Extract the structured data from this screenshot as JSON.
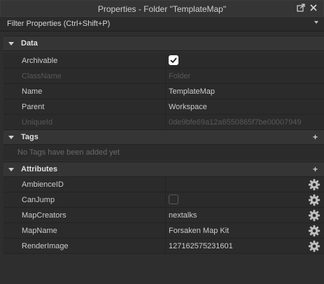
{
  "window": {
    "title": "Properties - Folder \"TemplateMap\""
  },
  "filter": {
    "placeholder": "Filter Properties (Ctrl+Shift+P)"
  },
  "sections": {
    "data": {
      "label": "Data"
    },
    "tags": {
      "label": "Tags",
      "empty_text": "No Tags have been added yet"
    },
    "attributes": {
      "label": "Attributes"
    }
  },
  "data_rows": {
    "archivable": {
      "name": "Archivable",
      "checked": true
    },
    "classname": {
      "name": "ClassName",
      "value": "Folder"
    },
    "name": {
      "name": "Name",
      "value": "TemplateMap"
    },
    "parent": {
      "name": "Parent",
      "value": "Workspace"
    },
    "uniqueid": {
      "name": "UniqueId",
      "value": "0de9bfe69a12a6550865f7be00007949"
    }
  },
  "attribute_rows": {
    "ambienceid": {
      "name": "AmbienceID",
      "value": ""
    },
    "canjump": {
      "name": "CanJump",
      "checked": false
    },
    "mapcreators": {
      "name": "MapCreators",
      "value": "nextalks"
    },
    "mapname": {
      "name": "MapName",
      "value": "Forsaken Map Kit"
    },
    "renderimage": {
      "name": "RenderImage",
      "value": "127162575231601"
    }
  },
  "icons": {
    "popout": "popout-icon",
    "close": "close-icon",
    "gear": "gear-icon",
    "add": "plus-icon"
  }
}
